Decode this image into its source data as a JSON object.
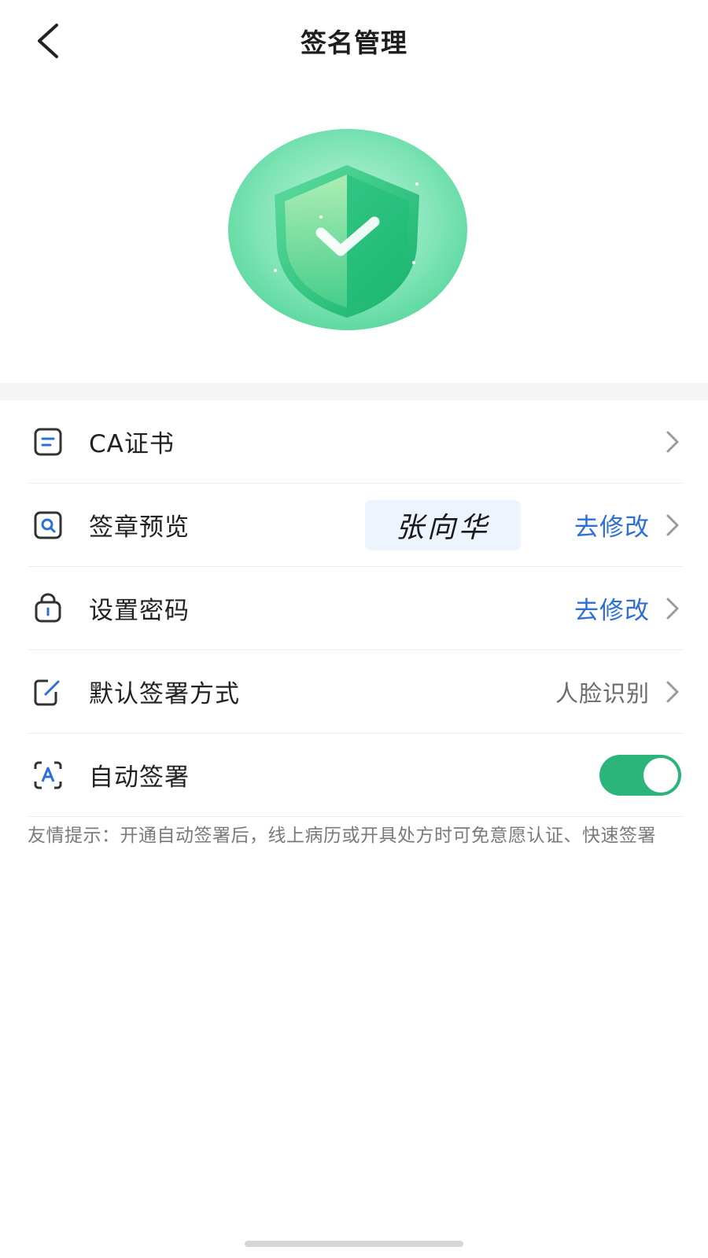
{
  "header": {
    "title": "签名管理"
  },
  "hero": {
    "icon": "shield-check-icon"
  },
  "rows": [
    {
      "icon": "certificate-icon",
      "label": "CA证书"
    },
    {
      "icon": "preview-search-icon",
      "label": "签章预览",
      "signature": "张向华",
      "action": "去修改"
    },
    {
      "icon": "lock-icon",
      "label": "设置密码",
      "action": "去修改"
    },
    {
      "icon": "edit-icon",
      "label": "默认签署方式",
      "value": "人脸识别"
    },
    {
      "icon": "auto-sign-icon",
      "label": "自动签署",
      "toggle_on": true
    }
  ],
  "tip": "友情提示：开通自动签署后，线上病历或开具处方时可免意愿认证、快速签署",
  "colors": {
    "accent": "#2d6fd6",
    "toggle": "#2bb57a",
    "shield": "#22c07c"
  }
}
